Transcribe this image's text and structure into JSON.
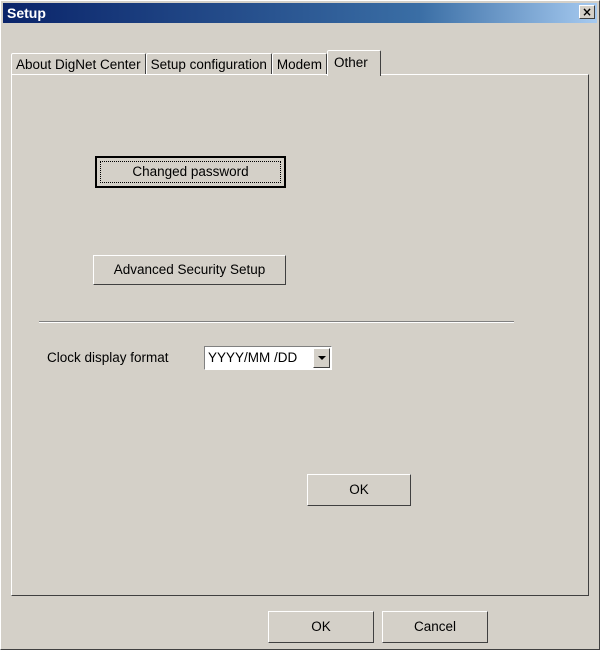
{
  "window": {
    "title": "Setup",
    "close_glyph": "×"
  },
  "tabs": [
    {
      "label": "About DigNet Center",
      "active": false
    },
    {
      "label": "Setup configuration",
      "active": false
    },
    {
      "label": "Modem",
      "active": false
    },
    {
      "label": "Other",
      "active": true
    }
  ],
  "panel": {
    "changed_password_label": "Changed password",
    "advanced_security_label": "Advanced Security Setup",
    "clock_format_label": "Clock display format",
    "clock_format_value": "YYYY/MM /DD",
    "ok_label": "OK"
  },
  "footer": {
    "ok_label": "OK",
    "cancel_label": "Cancel"
  },
  "colors": {
    "title_bar_start": "#0a246a",
    "title_bar_end": "#a6caf0",
    "dialog_face": "#d4d0c8"
  }
}
